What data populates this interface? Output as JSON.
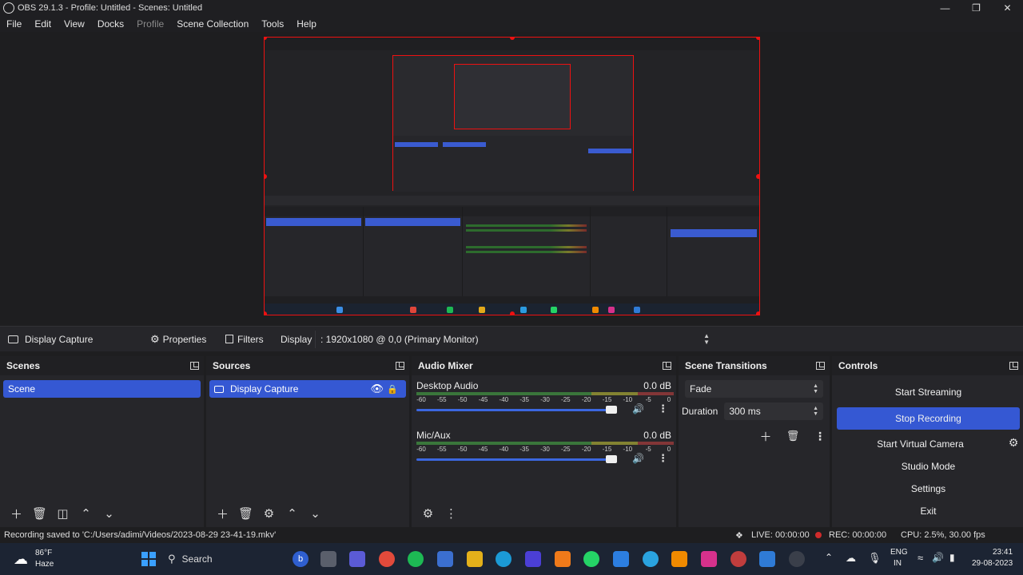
{
  "window": {
    "title": "OBS 29.1.3 - Profile: Untitled - Scenes: Untitled"
  },
  "menu": [
    "File",
    "Edit",
    "View",
    "Docks",
    "Profile",
    "Scene Collection",
    "Tools",
    "Help"
  ],
  "source_toolbar": {
    "source_name": "Display Capture",
    "properties": "Properties",
    "filters": "Filters",
    "display_label": "Display",
    "display_value": ": 1920x1080 @ 0,0 (Primary Monitor)"
  },
  "scenes": {
    "title": "Scenes",
    "items": [
      "Scene"
    ]
  },
  "sources": {
    "title": "Sources",
    "items": [
      "Display Capture"
    ]
  },
  "mixer": {
    "title": "Audio Mixer",
    "ticks": [
      "-60",
      "-55",
      "-50",
      "-45",
      "-40",
      "-35",
      "-30",
      "-25",
      "-20",
      "-15",
      "-10",
      "-5",
      "0"
    ],
    "channels": [
      {
        "name": "Desktop Audio",
        "level": "0.0 dB",
        "volume": 0.95
      },
      {
        "name": "Mic/Aux",
        "level": "0.0 dB",
        "volume": 0.95
      }
    ]
  },
  "transitions": {
    "title": "Scene Transitions",
    "selected": "Fade",
    "duration_label": "Duration",
    "duration_value": "300 ms"
  },
  "controls": {
    "title": "Controls",
    "start_streaming": "Start Streaming",
    "stop_recording": "Stop Recording",
    "start_virtual_camera": "Start Virtual Camera",
    "studio_mode": "Studio Mode",
    "settings": "Settings",
    "exit": "Exit"
  },
  "status": {
    "message": "Recording saved to 'C:/Users/adimi/Videos/2023-08-29 23-41-19.mkv'",
    "live": "LIVE: 00:00:00",
    "rec": "REC: 00:00:00",
    "cpu": "CPU: 2.5%, 30.00 fps"
  },
  "taskbar": {
    "weather_temp": "86°F",
    "weather_desc": "Haze",
    "search": "Search",
    "lang1": "ENG",
    "lang2": "IN",
    "time": "23:41",
    "date": "29-08-2023"
  },
  "colors": {
    "accent": "#3558d3",
    "selection_border": "#e11111",
    "rec_dot": "#d02b2b"
  }
}
